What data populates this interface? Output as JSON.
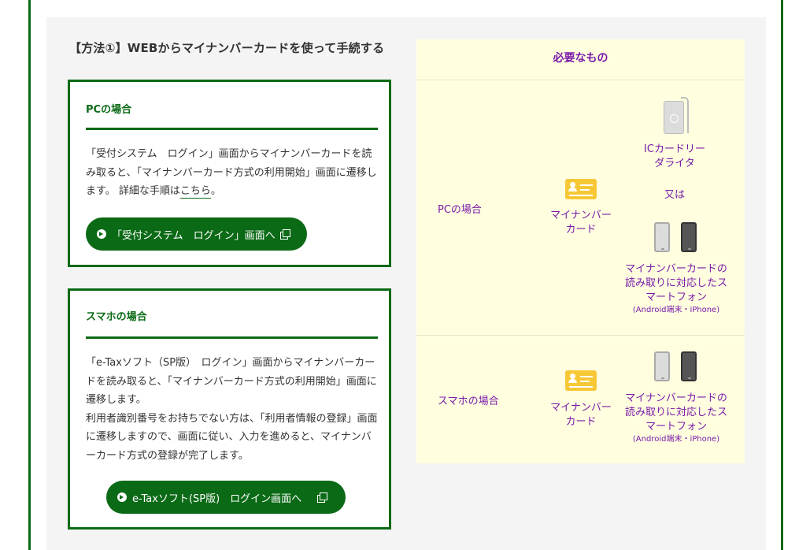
{
  "method": {
    "title": "【方法①】WEBからマイナンバーカードを使って手続する"
  },
  "pc_card": {
    "heading": "PCの場合",
    "text_before_link": "「受付システム　ログイン」画面からマイナンバーカードを読み取ると、「マイナンバーカード方式の利用開始」画面に遷移します。 詳細な手順は",
    "link_label": "こちら",
    "text_after_link": "。",
    "button_label": "「受付システム　ログイン」画面へ"
  },
  "sp_card": {
    "heading": "スマホの場合",
    "paragraph_1": "「e-Taxソフト（SP版）　ログイン」画面からマイナンバーカードを読み取ると、「マイナンバーカード方式の利用開始」画面に遷移します。",
    "paragraph_2": "利用者識別番号をお持ちでない方は、「利用者情報の登録」画面に遷移しますので、画面に従い、入力を進めると、マイナンバーカード方式の登録が完了します。",
    "button_label": "e-Taxソフト(SP版)　ログイン画面へ"
  },
  "requirements": {
    "header": "必要なもの",
    "pc_row": {
      "label": "PCの場合",
      "mynumber_card": "マイナンバーカード",
      "ic_reader": "ICカードリーダライタ",
      "or_label": "又は",
      "smartphone": "マイナンバーカードの読み取りに対応したスマートフォン",
      "smartphone_sub": "(Android端末・iPhone)"
    },
    "sp_row": {
      "label": "スマホの場合",
      "mynumber_card": "マイナンバーカード",
      "smartphone": "マイナンバーカードの読み取りに対応したスマートフォン",
      "smartphone_sub": "(Android端末・iPhone)"
    }
  },
  "icons": {
    "button_arrow": "circle-arrow-icon",
    "external_window": "external-window-icon",
    "mynumber_card": "id-card-icon",
    "ic_reader": "card-reader-icon",
    "smartphone": "smartphone-icon"
  },
  "colors": {
    "brand_green": "#0b6a16",
    "accent_purple": "#7a1aa8",
    "requirements_bg": "#ffffe0",
    "panel_bg": "#f4f4f4"
  }
}
